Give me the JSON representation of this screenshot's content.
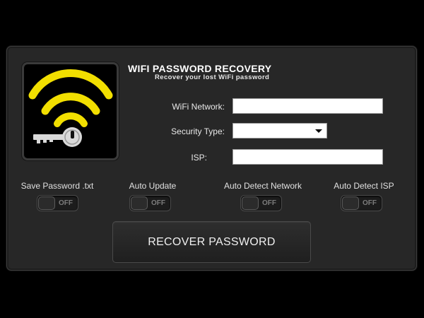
{
  "app": {
    "title": "WIFI PASSWORD RECOVERY",
    "subtitle": "Recover your lost WiFi password"
  },
  "logo": {
    "icon": "wifi-key-icon",
    "colors": {
      "waves": "#f2df00",
      "key": "#d9d9d9"
    }
  },
  "form": {
    "network": {
      "label": "WiFi Network:",
      "value": ""
    },
    "security": {
      "label": "Security Type:",
      "selected": ""
    },
    "isp": {
      "label": "ISP:",
      "value": ""
    }
  },
  "options": [
    {
      "label": "Save Password .txt",
      "state": "OFF"
    },
    {
      "label": "Auto Update",
      "state": "OFF"
    },
    {
      "label": "Auto Detect Network",
      "state": "OFF"
    },
    {
      "label": "Auto Detect ISP",
      "state": "OFF"
    }
  ],
  "recover_button": {
    "label": "RECOVER PASSWORD"
  }
}
